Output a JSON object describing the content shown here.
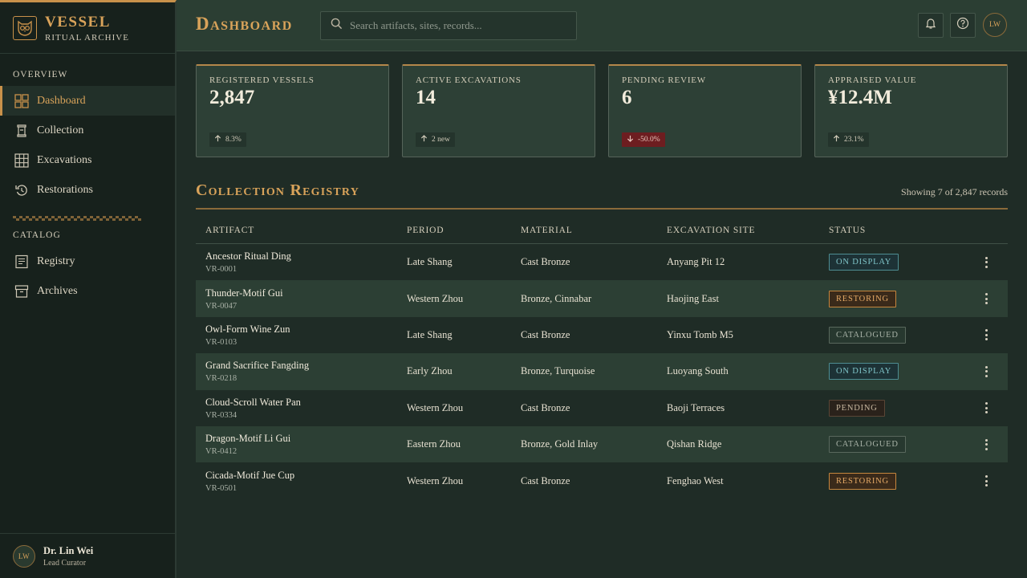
{
  "brand": {
    "title": "VESSEL",
    "subtitle": "RITUAL ARCHIVE",
    "logo_icon": "owl-icon",
    "accent": "#c8914a"
  },
  "sidebar": {
    "sections": [
      {
        "label": "OVERVIEW",
        "items": [
          {
            "label": "Dashboard",
            "icon": "grid-icon",
            "active": true
          },
          {
            "label": "Collection",
            "icon": "vessel-icon"
          },
          {
            "label": "Excavations",
            "icon": "grid-3x3-icon"
          },
          {
            "label": "Restorations",
            "icon": "restore-icon"
          }
        ]
      },
      {
        "label": "CATALOG",
        "items": [
          {
            "label": "Registry",
            "icon": "ledger-icon"
          },
          {
            "label": "Archives",
            "icon": "archive-box-icon"
          }
        ]
      }
    ],
    "user": {
      "initials": "LW",
      "name": "Dr. Lin Wei",
      "role": "Lead Curator"
    }
  },
  "header": {
    "title": "Dashboard",
    "search_placeholder": "Search artifacts, sites, records...",
    "avatar_initials": "LW"
  },
  "stats": [
    {
      "label": "REGISTERED VESSELS",
      "value": "2,847",
      "delta": "8.3%",
      "trend": "up"
    },
    {
      "label": "ACTIVE EXCAVATIONS",
      "value": "14",
      "delta": "2 new",
      "trend": "up"
    },
    {
      "label": "PENDING REVIEW",
      "value": "6",
      "delta": "-50.0%",
      "trend": "down"
    },
    {
      "label": "APPRAISED VALUE",
      "value": "¥12.4M",
      "delta": "23.1%",
      "trend": "up"
    }
  ],
  "registry": {
    "title": "Collection Registry",
    "count_text": "Showing 7 of 2,847 records",
    "columns": [
      "ARTIFACT",
      "PERIOD",
      "MATERIAL",
      "EXCAVATION SITE",
      "STATUS"
    ],
    "rows": [
      {
        "name": "Ancestor Ritual Ding",
        "id": "VR-0001",
        "period": "Late Shang",
        "material": "Cast Bronze",
        "site": "Anyang Pit 12",
        "status": "ON DISPLAY",
        "status_type": "display"
      },
      {
        "name": "Thunder-Motif Gui",
        "id": "VR-0047",
        "period": "Western Zhou",
        "material": "Bronze, Cinnabar",
        "site": "Haojing East",
        "status": "RESTORING",
        "status_type": "restoring"
      },
      {
        "name": "Owl-Form Wine Zun",
        "id": "VR-0103",
        "period": "Late Shang",
        "material": "Cast Bronze",
        "site": "Yinxu Tomb M5",
        "status": "CATALOGUED",
        "status_type": "catalogued"
      },
      {
        "name": "Grand Sacrifice Fangding",
        "id": "VR-0218",
        "period": "Early Zhou",
        "material": "Bronze, Turquoise",
        "site": "Luoyang South",
        "status": "ON DISPLAY",
        "status_type": "display"
      },
      {
        "name": "Cloud-Scroll Water Pan",
        "id": "VR-0334",
        "period": "Western Zhou",
        "material": "Cast Bronze",
        "site": "Baoji Terraces",
        "status": "PENDING",
        "status_type": "pending"
      },
      {
        "name": "Dragon-Motif Li Gui",
        "id": "VR-0412",
        "period": "Eastern Zhou",
        "material": "Bronze, Gold Inlay",
        "site": "Qishan Ridge",
        "status": "CATALOGUED",
        "status_type": "catalogued"
      },
      {
        "name": "Cicada-Motif Jue Cup",
        "id": "VR-0501",
        "period": "Western Zhou",
        "material": "Cast Bronze",
        "site": "Fenghao West",
        "status": "RESTORING",
        "status_type": "restoring"
      }
    ]
  }
}
